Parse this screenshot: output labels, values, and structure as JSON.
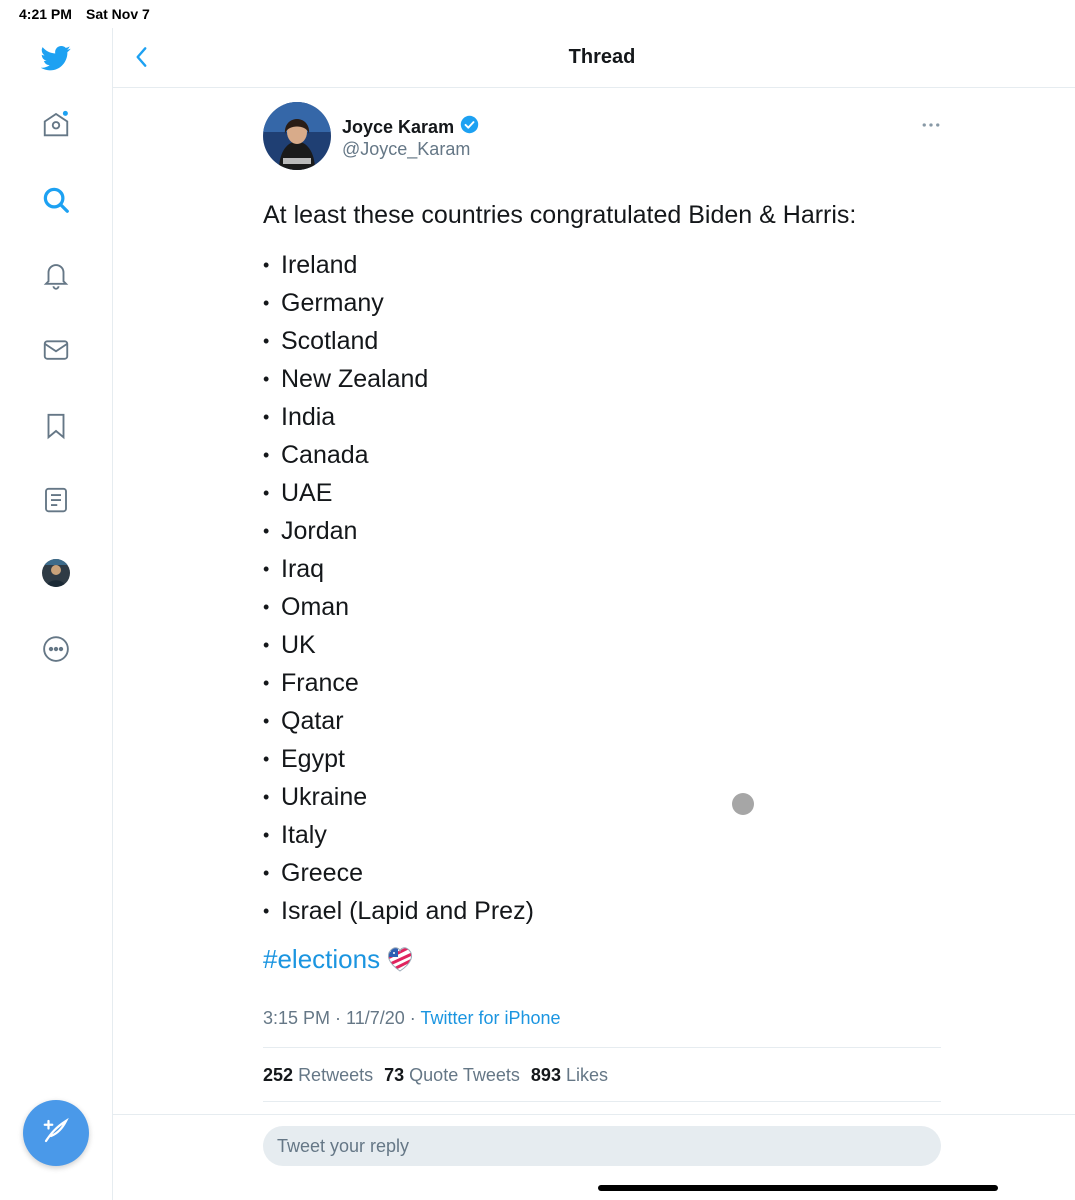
{
  "status_bar": {
    "time": "4:21 PM",
    "date": "Sat Nov 7"
  },
  "header": {
    "title": "Thread"
  },
  "sidebar": {
    "items": [
      {
        "name": "twitter-logo-icon"
      },
      {
        "name": "home-icon"
      },
      {
        "name": "search-icon"
      },
      {
        "name": "notifications-icon"
      },
      {
        "name": "messages-icon"
      },
      {
        "name": "bookmarks-icon"
      },
      {
        "name": "lists-icon"
      },
      {
        "name": "profile-avatar"
      },
      {
        "name": "more-icon"
      }
    ],
    "compose_icon": "compose-tweet-icon"
  },
  "tweet": {
    "author_name": "Joyce Karam",
    "author_handle": "@Joyce_Karam",
    "verified": true,
    "intro": "At least these countries congratulated Biden & Harris:",
    "bullet": "•",
    "countries": [
      "Ireland",
      "Germany",
      "Scotland",
      "New Zealand",
      "India",
      "Canada",
      "UAE",
      "Jordan",
      "Iraq",
      "Oman",
      "UK",
      "France",
      "Qatar",
      "Egypt",
      "Ukraine",
      "Italy",
      "Greece",
      "Israel (Lapid and Prez)"
    ],
    "hashtag": "#elections",
    "time": "3:15 PM",
    "date": "11/7/20",
    "meta_separator": " · ",
    "source": "Twitter for iPhone",
    "retweets_count": "252",
    "retweets_label": "Retweets",
    "quote_count": "73",
    "quote_label": "Quote Tweets",
    "likes_count": "893",
    "likes_label": "Likes"
  },
  "reply": {
    "placeholder": "Tweet your reply"
  },
  "colors": {
    "accent": "#1da1f2",
    "link": "#1b95e0",
    "muted": "#657786",
    "border": "#e6ecf0"
  }
}
